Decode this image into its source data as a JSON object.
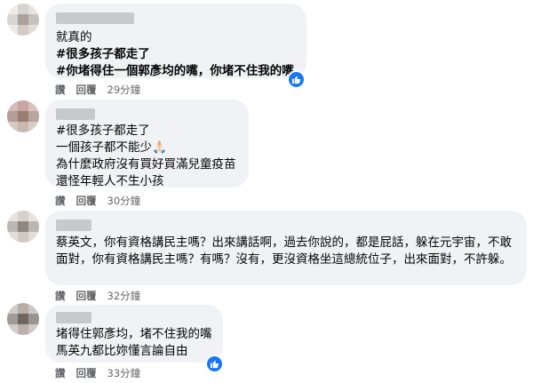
{
  "comments": [
    {
      "lines": [
        "就真的",
        "#很多孩子都走了",
        "#你堵得住一個郭彥均的嘴，你堵不住我的嘴"
      ],
      "actions": {
        "like": "讚",
        "reply": "回覆",
        "time": "29分鐘"
      }
    },
    {
      "lines": [
        "#很多孩子都走了",
        "一個孩子都不能少🙏🏻",
        "為什麼政府沒有買好買滿兒童疫苗",
        "還怪年輕人不生小孩"
      ],
      "actions": {
        "like": "讚",
        "reply": "回覆",
        "time": "30分鐘"
      }
    },
    {
      "paragraph": "蔡英文，你有資格講民主嗎？出來講話啊，過去你說的，都是屁話，躲在元宇宙，不敢面對，你有資格講民主嗎？有嗎？沒有，更沒資格坐這總統位子，出來面對，不許躲。",
      "actions": {
        "like": "讚",
        "reply": "回覆",
        "time": "32分鐘"
      }
    },
    {
      "lines": [
        "堵得住郭彥均，堵不住我的嘴",
        "馬英九都比妳懂言論自由"
      ],
      "actions": {
        "like": "讚",
        "reply": "回覆",
        "time": "33分鐘"
      }
    }
  ]
}
